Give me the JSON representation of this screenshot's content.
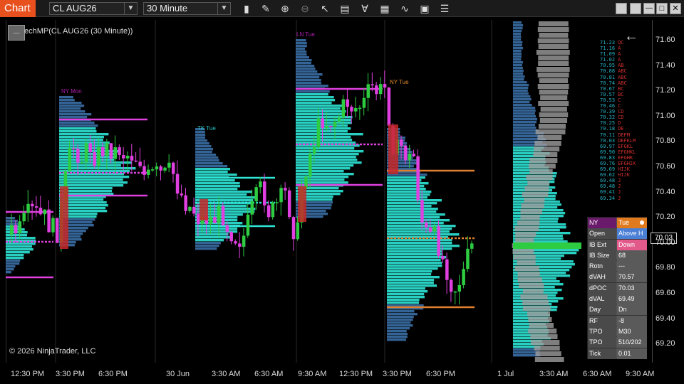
{
  "toolbar": {
    "tab_label": "Chart",
    "instrument": "CL AUG26",
    "interval": "30 Minute",
    "icons": [
      "bar-style-icon",
      "draw-pencil-icon",
      "zoom-in-icon",
      "zoom-out-icon",
      "pointer-icon",
      "properties-icon",
      "indicators-icon",
      "strategies-icon",
      "drawing-tools-icon",
      "data-box-icon",
      "templates-icon"
    ]
  },
  "window": {
    "buttons": [
      "minimize",
      "restore",
      "maximize-box",
      "close"
    ]
  },
  "chart": {
    "indicator_label": "echMP(CL AUG26 (30 Minute))",
    "copyright": "© 2026 NinjaTrader, LLC",
    "price_ticks": [
      "71.60",
      "71.40",
      "71.20",
      "71.00",
      "70.80",
      "70.60",
      "70.40",
      "70.20",
      "70.00",
      "69.80",
      "69.60",
      "69.40",
      "69.20"
    ],
    "time_ticks": [
      "12:30 PM",
      "3:30 PM",
      "6:30 PM",
      "30 Jun",
      "3:30 AM",
      "6:30 AM",
      "9:30 AM",
      "12:30 PM",
      "3:30 PM",
      "6:30 PM",
      "1 Jul",
      "3:30 AM",
      "6:30 AM",
      "9:30 AM"
    ],
    "session_labels": [
      {
        "text": "NY Mon",
        "color": "#b01fb0"
      },
      {
        "text": "TK Tue",
        "color": "#29c6c6"
      },
      {
        "text": "LN Tue",
        "color": "#b01fb0"
      },
      {
        "text": "NY Tue",
        "color": "#e08a2e"
      }
    ],
    "last_price": "70.03",
    "colors": {
      "cyan": "#2ee6d6",
      "magenta": "#e040e0",
      "red": "#c62828",
      "green": "#2ecc40",
      "blue": "#3a6ea5",
      "orange": "#e0802e",
      "gray": "#9e9e9e"
    }
  },
  "tpo_list": [
    {
      "p": "71.23",
      "l": "QC"
    },
    {
      "p": "71.16",
      "l": "A"
    },
    {
      "p": "71.09",
      "l": "A"
    },
    {
      "p": "71.02",
      "l": "A"
    },
    {
      "p": "70.95",
      "l": "AB"
    },
    {
      "p": "70.88",
      "l": "ABC"
    },
    {
      "p": "70.81",
      "l": "ABC"
    },
    {
      "p": "70.74",
      "l": "ABC"
    },
    {
      "p": "70.67",
      "l": "BC"
    },
    {
      "p": "70.57",
      "l": "BC"
    },
    {
      "p": "70.53",
      "l": "C"
    },
    {
      "p": "70.46",
      "l": "C"
    },
    {
      "p": "70.39",
      "l": "CD"
    },
    {
      "p": "70.32",
      "l": "CD"
    },
    {
      "p": "70.25",
      "l": "D"
    },
    {
      "p": "70.18",
      "l": "DE"
    },
    {
      "p": "70.11",
      "l": "DEFM"
    },
    {
      "p": "70.03",
      "l": "DEFKLM"
    },
    {
      "p": "69.97",
      "l": "EFGKL"
    },
    {
      "p": "69.90",
      "l": "EFGHKL"
    },
    {
      "p": "69.83",
      "l": "EFGHK"
    },
    {
      "p": "69.76",
      "l": "EFGHIK"
    },
    {
      "p": "69.69",
      "l": "HIJK"
    },
    {
      "p": "69.62",
      "l": "HIJK"
    },
    {
      "p": "69.48",
      "l": "J"
    },
    {
      "p": "69.48",
      "l": "J"
    },
    {
      "p": "69.41",
      "l": "J"
    },
    {
      "p": "69.34",
      "l": "J"
    }
  ],
  "panel": {
    "header": {
      "key": "NY",
      "value": "Tue"
    },
    "rows": [
      {
        "key": "Open",
        "value": "Above H",
        "color": "#4a7fd6"
      },
      {
        "key": "IB Ext",
        "value": "Down",
        "color": "#e25a8a"
      },
      {
        "key": "IB Size",
        "value": "68"
      },
      {
        "key": "Rotn",
        "value": "---"
      },
      {
        "key": "dVAH",
        "value": "70.57"
      },
      {
        "key": "dPOC",
        "value": "70.03"
      },
      {
        "key": "dVAL",
        "value": "69.49"
      },
      {
        "key": "Day",
        "value": "Dn"
      },
      {
        "key": "RF",
        "value": "-8"
      },
      {
        "key": "TPO",
        "value": "M30"
      },
      {
        "key": "TPO",
        "value": "510/202"
      },
      {
        "key": "Tick",
        "value": "0.01"
      }
    ]
  }
}
